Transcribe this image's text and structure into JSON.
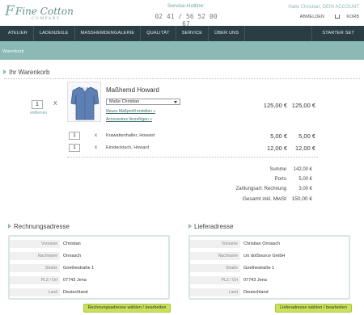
{
  "header": {
    "logo_mark": "F",
    "logo_name": "Fine Cotton",
    "logo_sub": "COMPANY",
    "hotline_label": "Service-Hotline:",
    "hotline_number": "02 41 / 56 52 00 67",
    "greeting": "Hallo Christian, DEIN ACCOUNT",
    "logout": "ABMELDEN",
    "cart": "KORB"
  },
  "nav": {
    "items": [
      "ATELIER",
      "LADENZEILE",
      "MASSHEMDENGALERIE",
      "QUALITÄT",
      "SERVICE",
      "ÜBER UNS"
    ],
    "right": "STARTER SET"
  },
  "breadcrumb": "Warenkorb",
  "cart": {
    "title": "Ihr Warenkorb",
    "product": {
      "qty": "1",
      "x": "X",
      "remove": "entfernen",
      "name": "Maßhemd Howard",
      "select_value": "Maße Christian",
      "link1": "Neues Maßprofil erstellen »",
      "link2": "Accessoires hinzufügen »",
      "unit_price": "125,00 €",
      "total_price": "125,00 €"
    },
    "accessories": [
      {
        "qty": "1",
        "x": "x",
        "name": "Krawattenhalter, Howard",
        "unit": "5,00 €",
        "total": "5,00 €"
      },
      {
        "qty": "1",
        "x": "x",
        "name": "Einstecktuch, Howard",
        "unit": "12,00 €",
        "total": "12,00 €"
      }
    ],
    "totals": [
      {
        "label": "Summe",
        "value": "142,00 €"
      },
      {
        "label": "Porto",
        "value": "5,00 €"
      },
      {
        "label": "Zahlungsart: Rechnung",
        "value": "3,00 €"
      },
      {
        "label": "Gesamt inkl. MwSt",
        "value": "150,00 €"
      }
    ]
  },
  "billing": {
    "title": "Rechnungsadresse",
    "rows": [
      {
        "k": "Vorname",
        "v": "Christian"
      },
      {
        "k": "Nachname",
        "v": "Onnasch"
      },
      {
        "k": "Straße",
        "v": "Goethestraße 1"
      },
      {
        "k": "PLZ / Ort",
        "v": "07743 Jena"
      },
      {
        "k": "Land",
        "v": "Deutschland"
      }
    ],
    "button": "Rechnungsadresse wählen / bearbeiten"
  },
  "shipping": {
    "title": "Lieferadresse",
    "rows": [
      {
        "k": "Vorname",
        "v": "Christian Onnasch"
      },
      {
        "k": "Nachname",
        "v": "c/o dotSource GmbH"
      },
      {
        "k": "Straße",
        "v": "Goethestraße 1"
      },
      {
        "k": "PLZ / Ort",
        "v": "07743 Jena"
      },
      {
        "k": "Land",
        "v": "Deutschland"
      }
    ],
    "button": "Lieferadresse wählen / bearbeiten"
  },
  "colors": {
    "nav": "#2a3d44",
    "accent": "#8bb9b4",
    "button": "#c9e25a"
  }
}
